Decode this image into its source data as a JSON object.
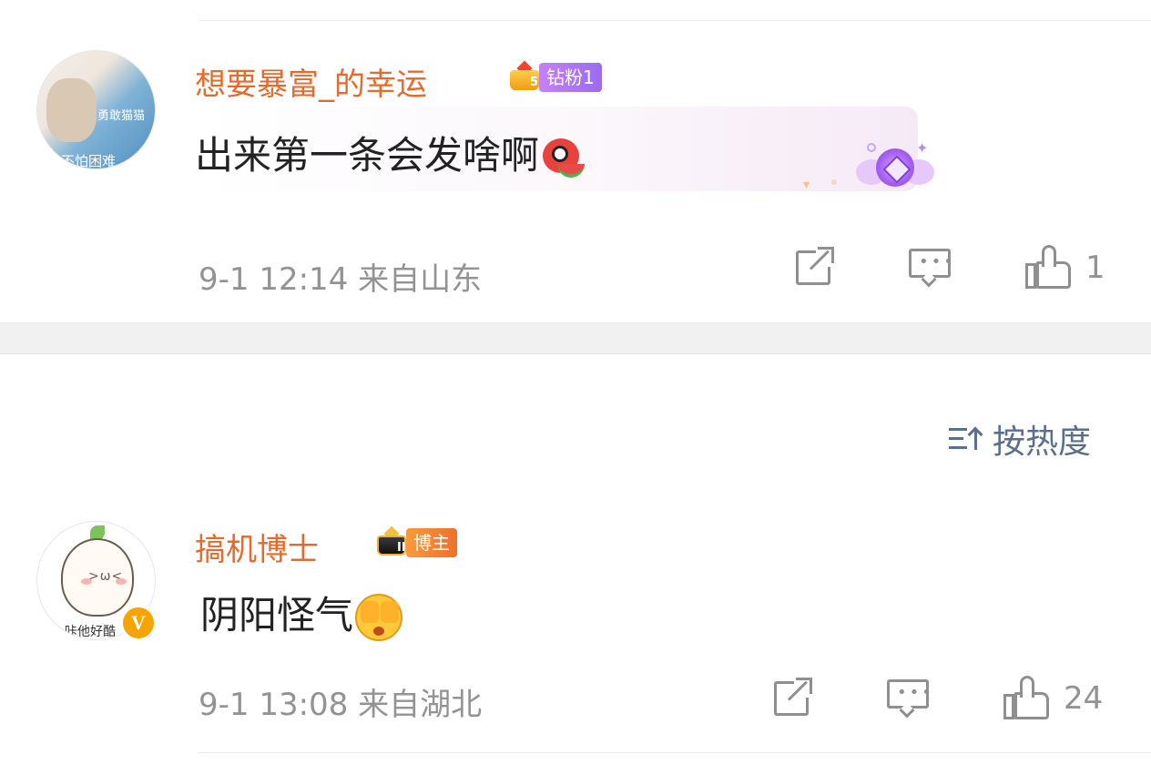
{
  "comments": [
    {
      "username": "想要暴富_的幸运",
      "badge_level": "5",
      "badge_label": "钻粉1",
      "text": "出来第一条会发啥啊",
      "emoji": "red-eye-mascot-emoji",
      "avatar_caption_top": "勇敢猫猫",
      "avatar_caption_bottom": "不怕困难",
      "time": "9-1 12:14",
      "location": "来自山东",
      "likes": "1"
    },
    {
      "username": "搞机博士",
      "badge_level": "II",
      "badge_label": "博主",
      "text": "阴阳怪气",
      "emoji": "shy-cover-face-emoji",
      "avatar_caption": "咔他好酷",
      "verified_mark": "V",
      "time": "9-1 13:08",
      "location": "来自湖北",
      "likes": "24"
    }
  ],
  "sort": {
    "label": "按热度",
    "icon": "sort-icon"
  },
  "colors": {
    "username": "#e8692a",
    "meta": "#939393",
    "sort": "#5b6e8a",
    "fan_badge": "#9a6bf0",
    "blogger_badge": "#f0702a"
  }
}
